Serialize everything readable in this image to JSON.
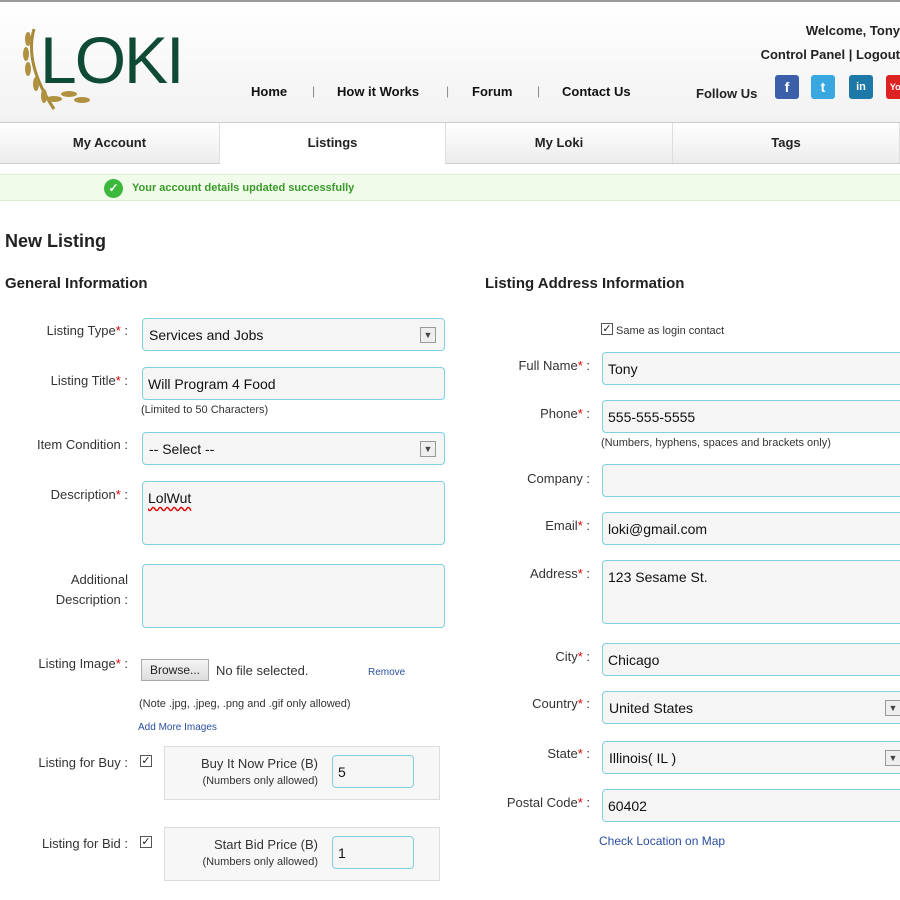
{
  "header": {
    "logo": "LOKI",
    "welcome": "Welcome, Tony",
    "control_panel": "Control Panel | Logout",
    "follow_us": "Follow Us",
    "nav": [
      "Home",
      "How it Works",
      "Forum",
      "Contact Us"
    ],
    "social": [
      "f",
      "t",
      "in",
      "You"
    ]
  },
  "tabs": [
    "My Account",
    "Listings",
    "My Loki",
    "Tags"
  ],
  "message": "Your account details updated successfully",
  "page_title": "New Listing",
  "general": {
    "title": "General Information",
    "listing_type_label": "Listing Type",
    "listing_type": "Services and Jobs",
    "listing_title_label": "Listing Title",
    "listing_title": "Will Program 4 Food",
    "title_hint": "(Limited to 50 Characters)",
    "condition_label": "Item Condition :",
    "condition": "-- Select --",
    "description_label": "Description",
    "description": "LolWut",
    "additional_label1": "Additional",
    "additional_label2": "Description :",
    "image_label": "Listing Image",
    "browse": "Browse...",
    "no_file": "No file selected.",
    "remove": "Remove",
    "image_note": "(Note .jpg, .jpeg, .png and .gif only allowed)",
    "add_more": "Add More Images",
    "buy_label": "Listing for Buy :",
    "buy_price_label": "Buy It Now Price (B)",
    "numbers_only": "(Numbers only allowed)",
    "buy_price": "5",
    "bid_label": "Listing for Bid :",
    "bid_price_label": "Start Bid Price (B)",
    "bid_price": "1"
  },
  "address": {
    "title": "Listing Address Information",
    "same_as_login": "Same as login contact",
    "full_name_label": "Full Name",
    "full_name": "Tony",
    "phone_label": "Phone",
    "phone": "555-555-5555",
    "phone_hint": "(Numbers, hyphens, spaces and brackets only)",
    "company_label": "Company :",
    "company": "",
    "email_label": "Email",
    "email": "loki@gmail.com",
    "address_label": "Address",
    "address": "123 Sesame St.",
    "city_label": "City",
    "city": "Chicago",
    "country_label": "Country",
    "country": "United States",
    "state_label": "State",
    "state": "Illinois( IL )",
    "postal_label": "Postal Code",
    "postal": "60402",
    "map_link": "Check Location on Map"
  }
}
